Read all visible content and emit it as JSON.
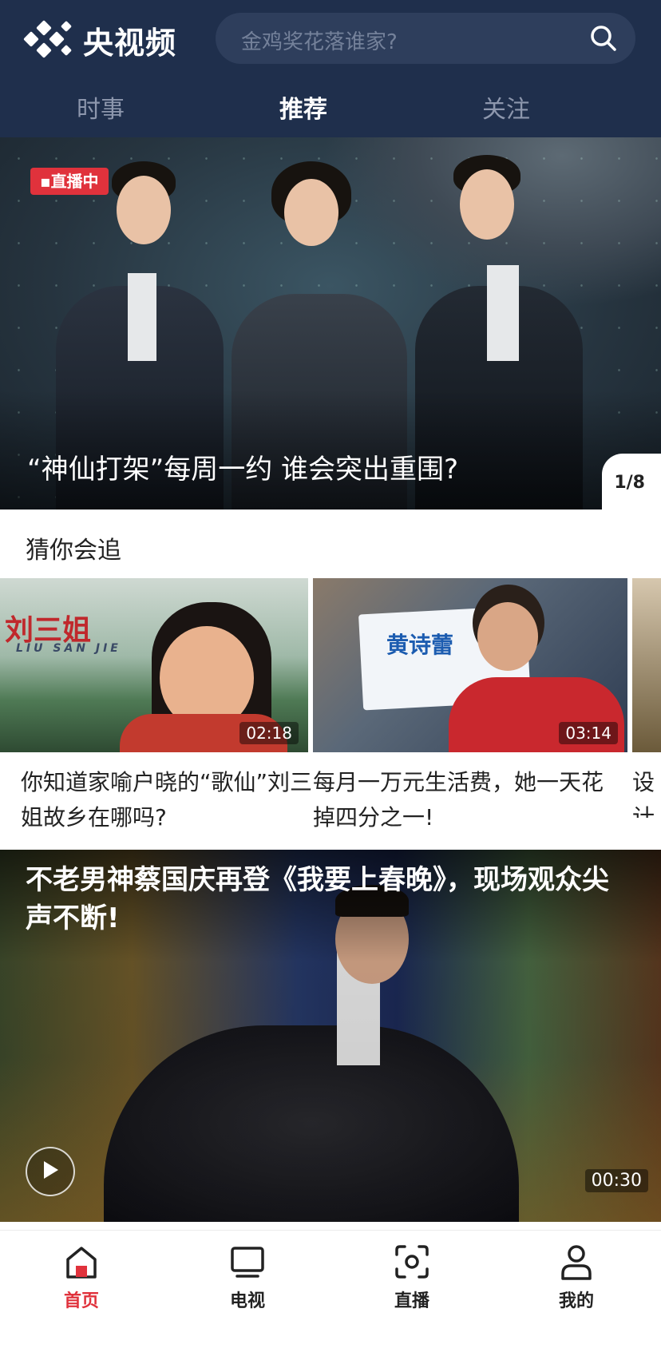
{
  "app": {
    "name": "央视频"
  },
  "search": {
    "placeholder": "金鸡奖花落谁家?"
  },
  "tabs": [
    {
      "label": "时事"
    },
    {
      "label": "推荐"
    },
    {
      "label": "关注"
    }
  ],
  "hero": {
    "badge": "直播中",
    "title": "“神仙打架”每周一约 谁会突出重围?",
    "page_indicator": "1/8"
  },
  "recommend": {
    "title": "猜你会追",
    "cards": [
      {
        "title": "你知道家喻户晓的“歌仙”刘三姐故乡在哪吗?",
        "duration": "02:18",
        "poster_text": "刘三姐",
        "poster_subtext": "LIU SAN JIE"
      },
      {
        "title": "每月一万元生活费，她一天花掉四分之一!",
        "duration": "03:14",
        "poster_text": "黄诗蕾"
      },
      {
        "title": "设计厅变"
      }
    ]
  },
  "feature": {
    "title": "不老男神蔡国庆再登《我要上春晚》，现场观众尖声不断!",
    "duration": "00:30"
  },
  "bottom_nav": [
    {
      "label": "首页",
      "icon": "home-icon",
      "active": true
    },
    {
      "label": "电视",
      "icon": "tv-icon",
      "active": false
    },
    {
      "label": "直播",
      "icon": "live-icon",
      "active": false
    },
    {
      "label": "我的",
      "icon": "profile-icon",
      "active": false
    }
  ],
  "colors": {
    "header_bg": "#1f2f4c",
    "accent_red": "#e0323c"
  }
}
